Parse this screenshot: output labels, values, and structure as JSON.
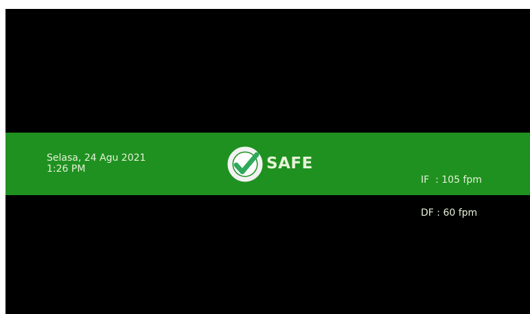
{
  "colors": {
    "background": "#000000",
    "banner": "#1f9120",
    "text": "#e6f2d8"
  },
  "banner": {
    "date": "Selasa, 24 Agu 2021",
    "time": "1:26 PM",
    "status": {
      "icon": "check-circle-icon",
      "label": "SAFE"
    },
    "speeds": {
      "if": "IF  : 105 fpm",
      "df": "DF : 60 fpm"
    }
  }
}
